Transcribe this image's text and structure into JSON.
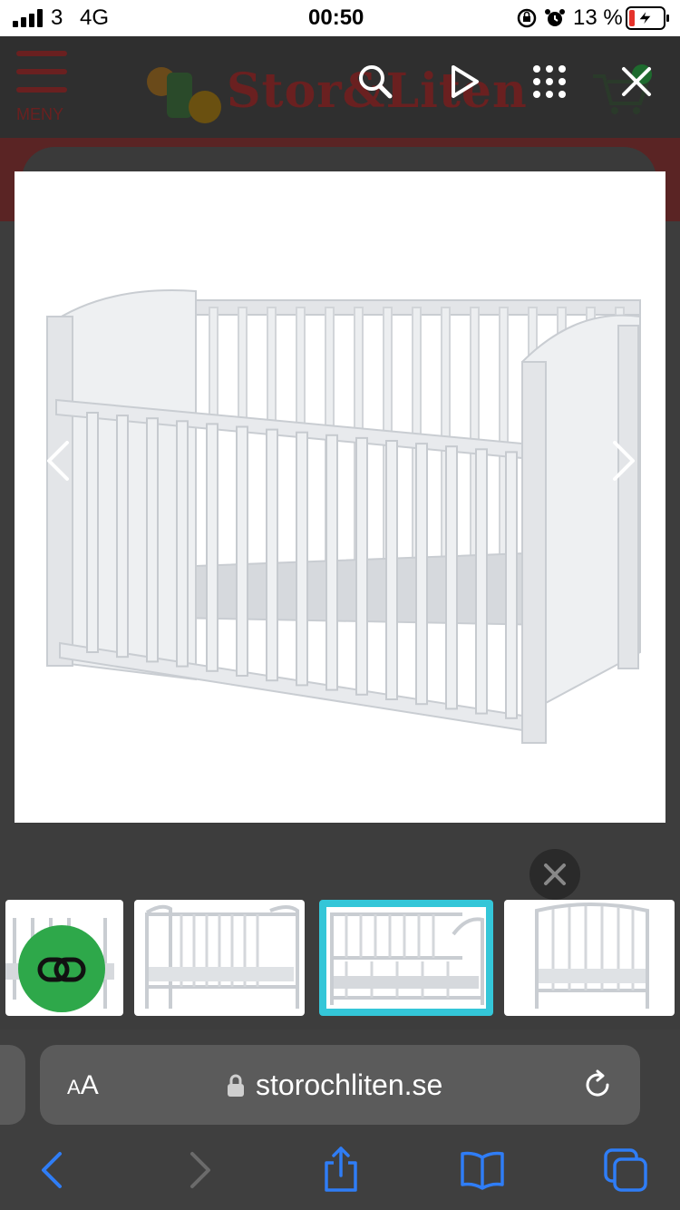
{
  "status_bar": {
    "carrier": "3",
    "network": "4G",
    "time": "00:50",
    "battery_percent": "13 %",
    "icons": [
      "signal-icon",
      "orientation-lock-icon",
      "alarm-icon",
      "battery-charging-icon"
    ]
  },
  "website_behind": {
    "menu_label": "MENY",
    "logo_text": "Stor&Liten"
  },
  "viewer": {
    "toolbar_icons": [
      "search-icon",
      "play-icon",
      "grid-icon",
      "close-icon"
    ],
    "nav_icons": [
      "chevron-left-icon",
      "chevron-right-icon"
    ],
    "main_image_subject": "crib",
    "thumbnails": [
      {
        "subject": "crib-side-partial",
        "selected": false
      },
      {
        "subject": "crib-side",
        "selected": false
      },
      {
        "subject": "crib-side-rail-lowered",
        "selected": true
      },
      {
        "subject": "crib-end",
        "selected": false
      }
    ],
    "selection_color": "#34c6d8",
    "green_button_color": "#2ea84a"
  },
  "safari": {
    "text_size_label": "AA",
    "url": "storochliten.se",
    "icons": [
      "lock-icon",
      "reload-icon",
      "back-icon",
      "forward-icon",
      "share-icon",
      "bookmarks-icon",
      "tabs-icon"
    ],
    "accent": "#2f7df6"
  }
}
